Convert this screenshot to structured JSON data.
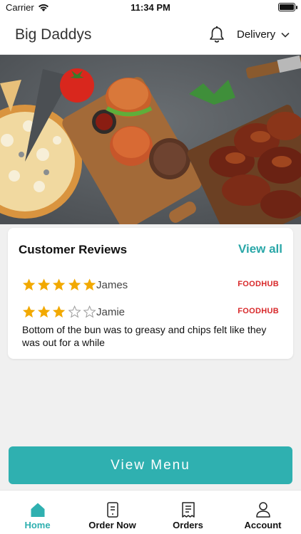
{
  "status_bar": {
    "carrier": "Carrier",
    "time": "11:34 PM"
  },
  "header": {
    "title": "Big Daddys",
    "delivery_label": "Delivery"
  },
  "hero": {
    "icon": "food-banner-image"
  },
  "reviews": {
    "title": "Customer Reviews",
    "view_all": "View all",
    "items": [
      {
        "stars": 5,
        "name": "James",
        "source": "FOODHUB",
        "text": ""
      },
      {
        "stars": 3,
        "name": "Jamie",
        "source": "FOODHUB",
        "text": "Bottom of the bun was to greasy and chips felt like they was out for a while"
      }
    ]
  },
  "view_menu_label": "View Menu",
  "nav": {
    "items": [
      {
        "label": "Home",
        "icon": "home-icon",
        "active": true
      },
      {
        "label": "Order Now",
        "icon": "order-now-icon",
        "active": false
      },
      {
        "label": "Orders",
        "icon": "receipt-icon",
        "active": false
      },
      {
        "label": "Account",
        "icon": "account-icon",
        "active": false
      }
    ]
  },
  "colors": {
    "accent": "#2fb0b0",
    "star": "#f2a900",
    "foodhub": "#d8282a"
  }
}
